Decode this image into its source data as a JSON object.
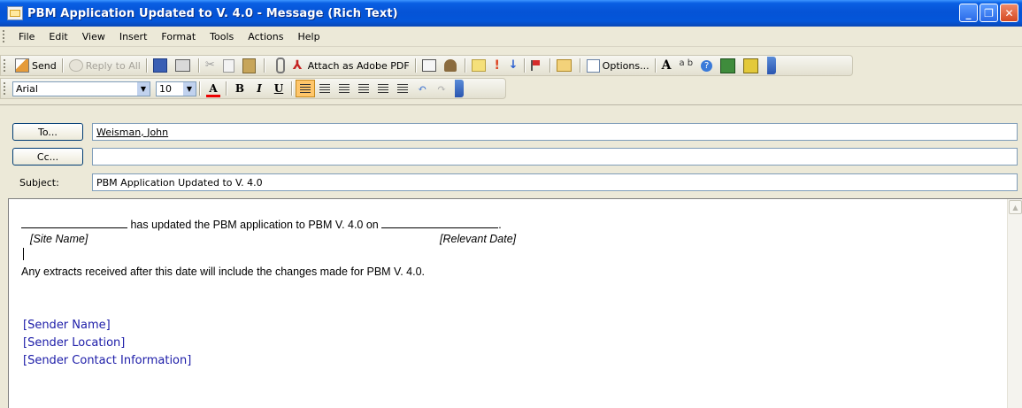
{
  "window": {
    "title": "PBM Application Updated to V. 4.0 - Message (Rich Text)",
    "buttons": {
      "minimize": "_",
      "maximize": "❐",
      "close": "✕"
    }
  },
  "menu": [
    "File",
    "Edit",
    "View",
    "Insert",
    "Format",
    "Tools",
    "Actions",
    "Help"
  ],
  "toolbar": {
    "send_label": "Send",
    "reply_all_label": "Reply to All",
    "attach_pdf_label": "Attach as Adobe PDF",
    "options_label": "Options...",
    "cut": "✂",
    "high_importance": "!",
    "low_importance": "↓",
    "font_a": "A",
    "spelling": "a b",
    "help": "?"
  },
  "formatting": {
    "font": "Arial",
    "size": "10",
    "bold": "B",
    "italic": "I",
    "underline": "U",
    "font_color_icon": "A",
    "undo": "↶",
    "redo": "↷"
  },
  "header": {
    "to_button": "To...",
    "to_value": "Weisman, John",
    "cc_button": "Cc...",
    "cc_value": "",
    "subject_label": "Subject:",
    "subject_value": "PBM Application Updated to V. 4.0"
  },
  "body": {
    "line1_middle": "has updated the PBM application to PBM V. 4.0 on",
    "line1_end": ".",
    "site_name_placeholder": "[Site Name]",
    "date_placeholder": "[Relevant Date]",
    "line2": "Any extracts received after this date will include the changes made for PBM V. 4.0.",
    "sender_name": "[Sender Name]",
    "sender_location": "[Sender Location]",
    "sender_contact": "[Sender Contact Information]"
  },
  "colors": {
    "titlebar": "#0553d6",
    "signature_text": "#1c1ca8",
    "active_align": "#ffc66a"
  }
}
